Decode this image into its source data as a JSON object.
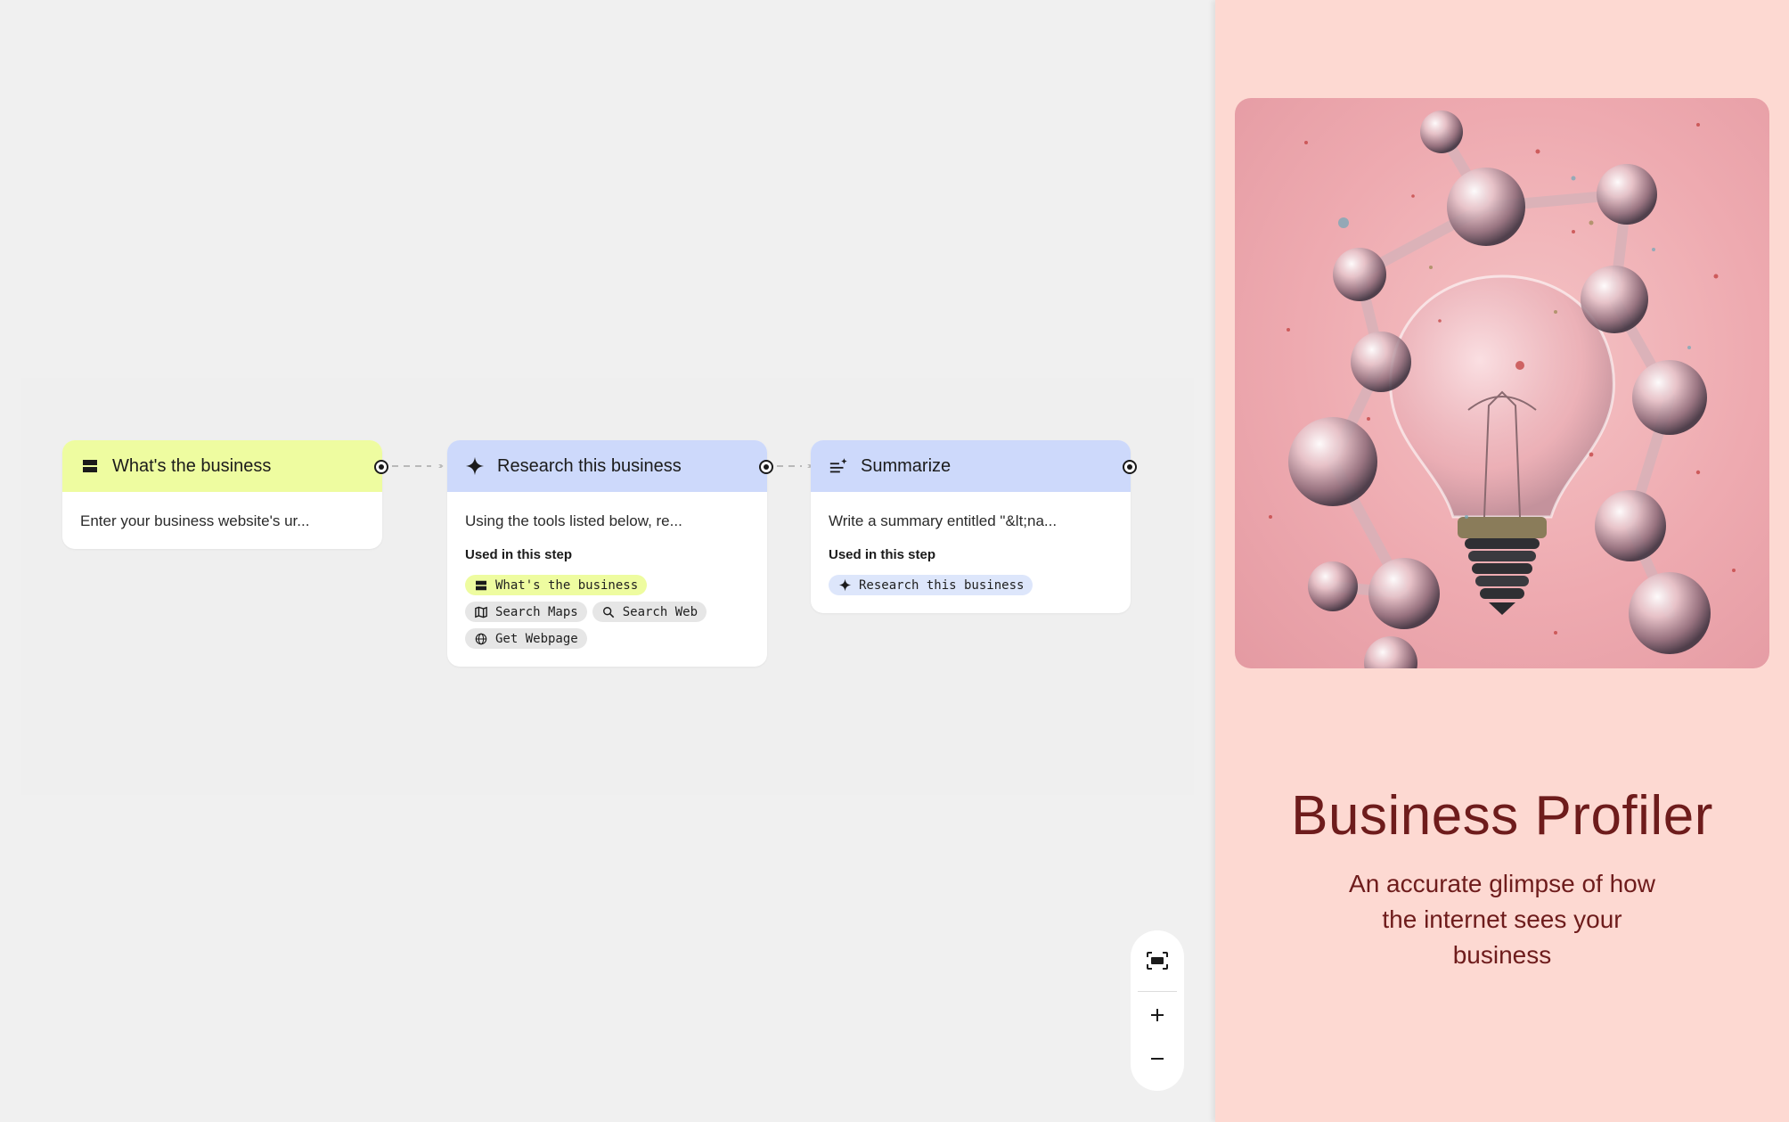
{
  "nodes": [
    {
      "title": "What's the business",
      "icon": "input-icon",
      "header_color": "#eefca0",
      "description": "Enter your business website's ur...",
      "used_label": "",
      "chips": []
    },
    {
      "title": "Research this business",
      "icon": "sparkle-icon",
      "header_color": "#cdd9fb",
      "description": "Using the tools listed below, re...",
      "used_label": "Used in this step",
      "chips": [
        {
          "label": "What's the business",
          "icon": "input-icon",
          "style": "yellow"
        },
        {
          "label": "Search Maps",
          "icon": "map-icon",
          "style": "gray"
        },
        {
          "label": "Search Web",
          "icon": "search-icon",
          "style": "gray"
        },
        {
          "label": "Get Webpage",
          "icon": "globe-icon",
          "style": "gray"
        }
      ]
    },
    {
      "title": "Summarize",
      "icon": "summarize-icon",
      "header_color": "#cdd9fb",
      "description": "Write a summary entitled \"&lt;na...",
      "used_label": "Used in this step",
      "chips": [
        {
          "label": "Research this business",
          "icon": "sparkle-icon",
          "style": "blue"
        }
      ]
    }
  ],
  "zoom_controls": {
    "fit_icon": "fit-to-screen-icon",
    "zoom_in_icon": "plus-icon",
    "zoom_out_icon": "minus-icon"
  },
  "panel": {
    "title": "Business Profiler",
    "subtitle": "An accurate glimpse of how the internet sees your business",
    "background": "#fdd9d2",
    "title_color": "#6e1c1c"
  }
}
